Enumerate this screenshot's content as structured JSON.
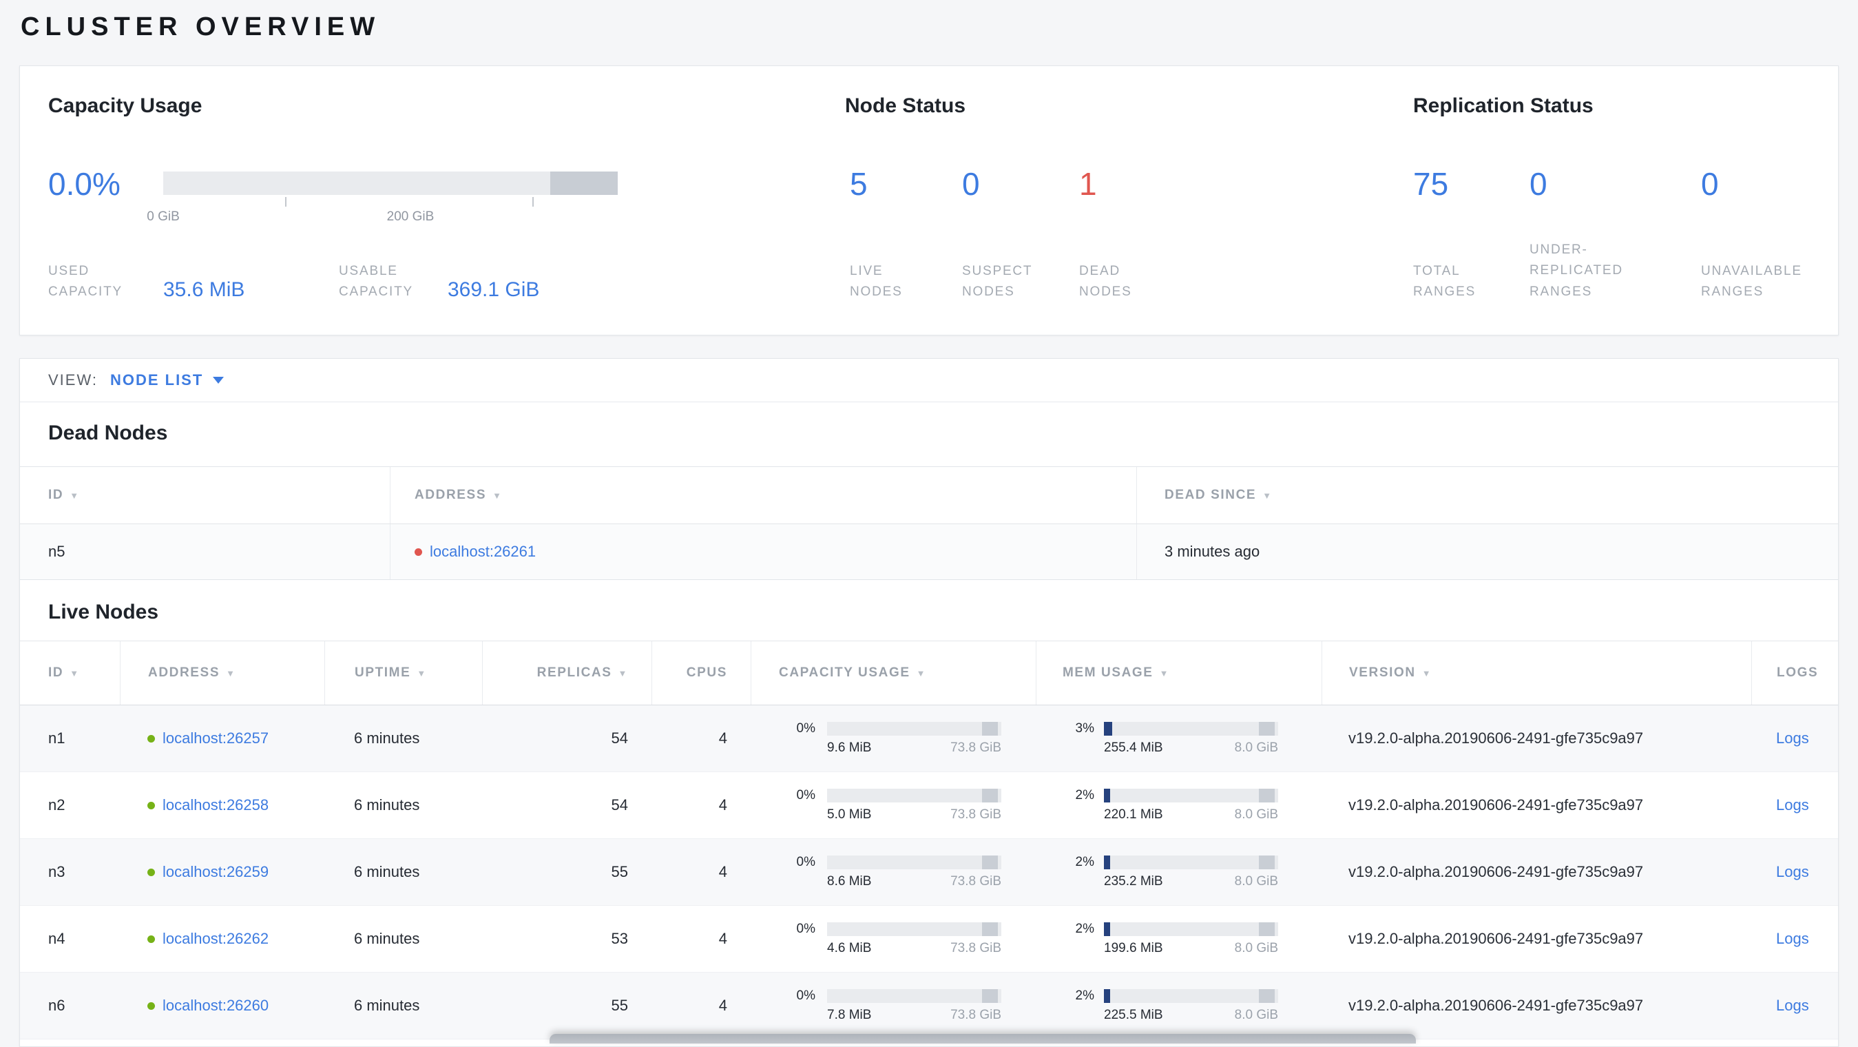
{
  "title": "CLUSTER OVERVIEW",
  "icons": {
    "sort_desc": "▼"
  },
  "colors": {
    "accent_blue": "#3d7be0",
    "alert_red": "#e0564f",
    "live_green": "#76b217"
  },
  "summary": {
    "capacity": {
      "title": "Capacity Usage",
      "percent": "0.0%",
      "tick_labels": [
        "0 GiB",
        "200 GiB"
      ],
      "used_label": "USED CAPACITY",
      "used_value": "35.6 MiB",
      "usable_label": "USABLE CAPACITY",
      "usable_value": "369.1 GiB"
    },
    "node_status": {
      "title": "Node Status",
      "stats": [
        {
          "value": "5",
          "label": "LIVE NODES"
        },
        {
          "value": "0",
          "label": "SUSPECT NODES"
        },
        {
          "value": "1",
          "label": "DEAD NODES"
        }
      ]
    },
    "replication": {
      "title": "Replication Status",
      "stats": [
        {
          "value": "75",
          "label": "TOTAL RANGES"
        },
        {
          "value": "0",
          "label": "UNDER-REPLICATED RANGES"
        },
        {
          "value": "0",
          "label": "UNAVAILABLE RANGES"
        }
      ]
    }
  },
  "view_bar": {
    "label": "VIEW:",
    "selected": "NODE LIST"
  },
  "dead_nodes": {
    "title": "Dead Nodes",
    "columns": [
      "ID",
      "ADDRESS",
      "DEAD SINCE"
    ],
    "rows": [
      {
        "id": "n5",
        "address": "localhost:26261",
        "dead_since": "3 minutes ago"
      }
    ]
  },
  "live_nodes": {
    "title": "Live Nodes",
    "columns": [
      "ID",
      "ADDRESS",
      "UPTIME",
      "REPLICAS",
      "CPUS",
      "CAPACITY USAGE",
      "MEM USAGE",
      "VERSION",
      "LOGS"
    ],
    "rows": [
      {
        "id": "n1",
        "address": "localhost:26257",
        "uptime": "6 minutes",
        "replicas": "54",
        "cpus": "4",
        "capacity_pct": "0%",
        "capacity_used": "9.6 MiB",
        "capacity_total": "73.8 GiB",
        "mem_pct": "3%",
        "mem_used": "255.4 MiB",
        "mem_total": "8.0 GiB",
        "version": "v19.2.0-alpha.20190606-2491-gfe735c9a97",
        "logs_label": "Logs"
      },
      {
        "id": "n2",
        "address": "localhost:26258",
        "uptime": "6 minutes",
        "replicas": "54",
        "cpus": "4",
        "capacity_pct": "0%",
        "capacity_used": "5.0 MiB",
        "capacity_total": "73.8 GiB",
        "mem_pct": "2%",
        "mem_used": "220.1 MiB",
        "mem_total": "8.0 GiB",
        "version": "v19.2.0-alpha.20190606-2491-gfe735c9a97",
        "logs_label": "Logs"
      },
      {
        "id": "n3",
        "address": "localhost:26259",
        "uptime": "6 minutes",
        "replicas": "55",
        "cpus": "4",
        "capacity_pct": "0%",
        "capacity_used": "8.6 MiB",
        "capacity_total": "73.8 GiB",
        "mem_pct": "2%",
        "mem_used": "235.2 MiB",
        "mem_total": "8.0 GiB",
        "version": "v19.2.0-alpha.20190606-2491-gfe735c9a97",
        "logs_label": "Logs"
      },
      {
        "id": "n4",
        "address": "localhost:26262",
        "uptime": "6 minutes",
        "replicas": "53",
        "cpus": "4",
        "capacity_pct": "0%",
        "capacity_used": "4.6 MiB",
        "capacity_total": "73.8 GiB",
        "mem_pct": "2%",
        "mem_used": "199.6 MiB",
        "mem_total": "8.0 GiB",
        "version": "v19.2.0-alpha.20190606-2491-gfe735c9a97",
        "logs_label": "Logs"
      },
      {
        "id": "n6",
        "address": "localhost:26260",
        "uptime": "6 minutes",
        "replicas": "55",
        "cpus": "4",
        "capacity_pct": "0%",
        "capacity_used": "7.8 MiB",
        "capacity_total": "73.8 GiB",
        "mem_pct": "2%",
        "mem_used": "225.5 MiB",
        "mem_total": "8.0 GiB",
        "version": "v19.2.0-alpha.20190606-2491-gfe735c9a97",
        "logs_label": "Logs"
      }
    ]
  }
}
